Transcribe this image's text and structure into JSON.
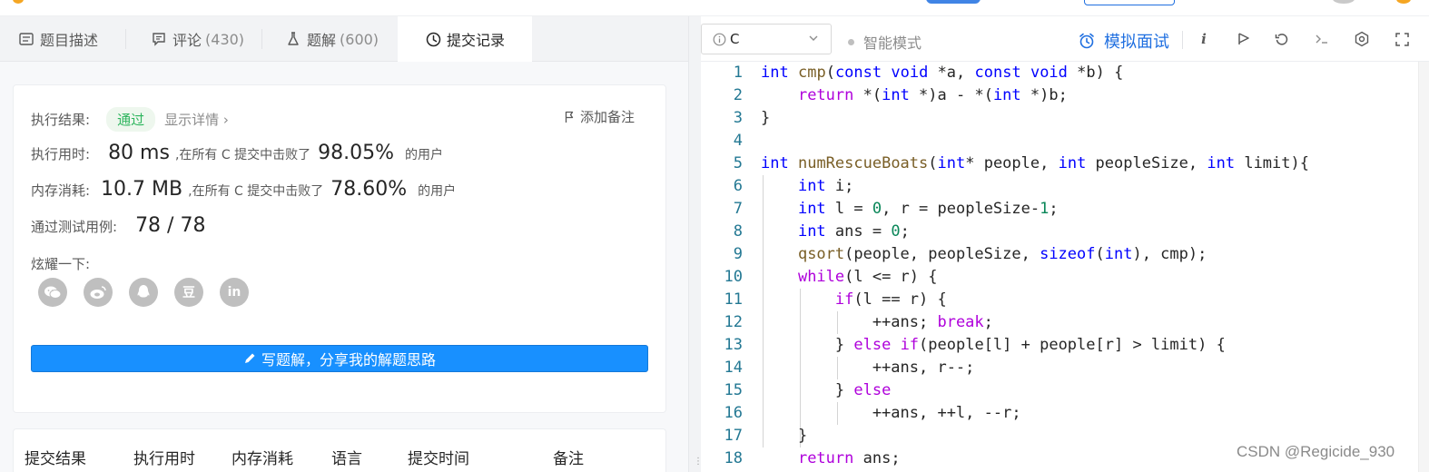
{
  "tabs": [
    {
      "label": "题目描述",
      "count": ""
    },
    {
      "label": "评论",
      "count": "(430)"
    },
    {
      "label": "题解",
      "count": "(600)"
    },
    {
      "label": "提交记录",
      "count": ""
    }
  ],
  "result": {
    "exec_label": "执行结果:",
    "status": "通过",
    "details_link": "显示详情",
    "add_note": "添加备注",
    "time_label": "执行用时:",
    "time_value": "80 ms",
    "time_beat_prefix": ",在所有 C 提交中击败了",
    "time_percent": "98.05%",
    "time_suffix": "的用户",
    "mem_label": "内存消耗:",
    "mem_value": "10.7 MB",
    "mem_beat_prefix": ",在所有 C 提交中击败了",
    "mem_percent": "78.60%",
    "mem_suffix": "的用户",
    "tests_label": "通过测试用例:",
    "tests_value": "78 / 78",
    "share_label": "炫耀一下:",
    "socials": [
      "wechat-icon",
      "weibo-icon",
      "qq-icon",
      "douban-icon",
      "linkedin-icon"
    ],
    "social_glyphs": [
      "",
      "",
      "",
      "豆",
      "in"
    ],
    "write_solution": "写题解，分享我的解题思路"
  },
  "table": {
    "headers": [
      "提交结果",
      "执行用时",
      "内存消耗",
      "语言",
      "提交时间",
      "备注"
    ]
  },
  "editor": {
    "language": "C",
    "smart_mode": "智能模式",
    "mock_interview": "模拟面试",
    "line_numbers": [
      "1",
      "2",
      "3",
      "4",
      "5",
      "6",
      "7",
      "8",
      "9",
      "10",
      "11",
      "12",
      "13",
      "14",
      "15",
      "16",
      "17",
      "18"
    ]
  },
  "watermark": "CSDN @Regicide_930",
  "colors": {
    "accent": "#1f6fe0",
    "pass": "#2db55d",
    "button": "#1890ff"
  }
}
